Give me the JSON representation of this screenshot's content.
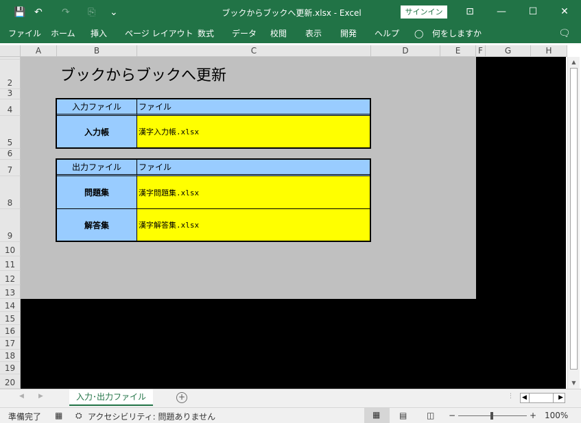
{
  "window": {
    "title": "ブックからブックへ更新.xlsx  -  Excel",
    "signin": "サインイン",
    "minimize": "—",
    "restore": "☐",
    "close": "✕",
    "ribbon_display": "⊡"
  },
  "qat": {
    "save": "💾",
    "undo": "↶",
    "redo": "↷",
    "touch": "⎘",
    "customize": "⌄"
  },
  "menu": [
    "ファイル",
    "ホーム",
    "挿入",
    "ページ レイアウト",
    "数式",
    "データ",
    "校閲",
    "表示",
    "開発",
    "ヘルプ",
    "何をしますか"
  ],
  "comment_icon": "🗨",
  "columns": [
    "A",
    "B",
    "C",
    "D",
    "E",
    "F",
    "G",
    "H"
  ],
  "rows": [
    "1",
    "2",
    "3",
    "4",
    "5",
    "6",
    "7",
    "8",
    "9",
    "10",
    "11",
    "12",
    "13",
    "14",
    "15",
    "16",
    "17",
    "18",
    "19",
    "20"
  ],
  "sheet": {
    "title": "ブックからブックへ更新",
    "input_table": {
      "header_label": "入力ファイル",
      "header_value": "ファイル",
      "rows": [
        {
          "label": "入力帳",
          "value": "漢字入力帳.xlsx"
        }
      ]
    },
    "output_table": {
      "header_label": "出力ファイル",
      "header_value": "ファイル",
      "rows": [
        {
          "label": "問題集",
          "value": "漢字問題集.xlsx"
        },
        {
          "label": "解答集",
          "value": "漢字解答集.xlsx"
        }
      ]
    }
  },
  "tabs": {
    "active": "入力･出力ファイル",
    "add": "+",
    "prev": "◀",
    "next": "▶"
  },
  "status": {
    "ready": "準備完了",
    "accessibility": "アクセシビリティ: 問題ありません",
    "zoom": "100%",
    "zoom_minus": "−",
    "zoom_plus": "+"
  },
  "colors": {
    "accent": "#217346",
    "label_fill": "#99ccff",
    "value_fill": "#ffff00",
    "gray_fill": "#c0c0c0"
  }
}
